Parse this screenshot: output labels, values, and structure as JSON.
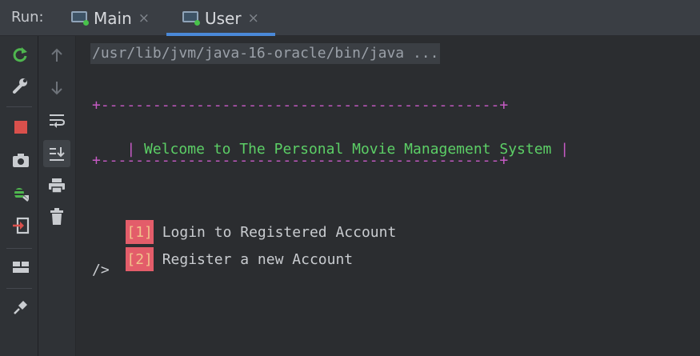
{
  "header": {
    "run_label": "Run:",
    "tabs": [
      {
        "label": "Main",
        "close": "×",
        "active": false
      },
      {
        "label": "User",
        "close": "×",
        "active": true
      }
    ]
  },
  "left_toolbar": {
    "icons": [
      "rerun-icon",
      "wrench-icon",
      "stop-icon",
      "camera-icon",
      "debug-icon",
      "exit-icon",
      "layout-icon",
      "pin-icon"
    ]
  },
  "mid_toolbar": {
    "icons": [
      "arrow-up-icon",
      "arrow-down-icon",
      "soft-wrap-icon",
      "scroll-to-end-icon",
      "print-icon",
      "trash-icon"
    ]
  },
  "console": {
    "command": "/usr/lib/jvm/java-16-oracle/bin/java ...",
    "border": "+----------------------------------------------+",
    "welcome_left": "| ",
    "welcome_text": "Welcome to The Personal Movie Management System",
    "welcome_right": " |",
    "options": [
      {
        "tag": "[1]",
        "text": " Login to Registered Account"
      },
      {
        "tag": "[2]",
        "text": " Register a new Account"
      }
    ],
    "prompt": "/>"
  },
  "colors": {
    "accent": "#4a89d8",
    "border": "#c65ac4",
    "welcome": "#5ccf66",
    "option_tag_bg": "#e35d6a",
    "option_tag_fg": "#f2c38b"
  }
}
